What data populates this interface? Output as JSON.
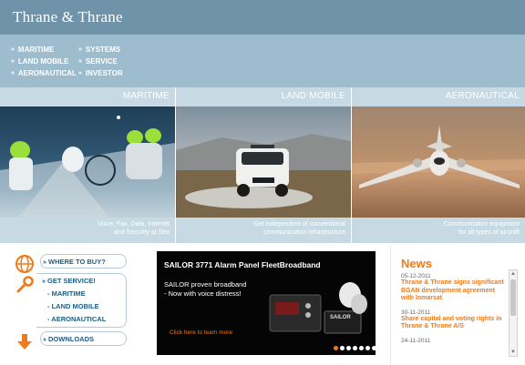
{
  "header": {
    "logo": "Thrane & Thrane"
  },
  "nav": {
    "col1": [
      "MARITIME",
      "LAND MOBILE",
      "AERONAUTICAL"
    ],
    "col2": [
      "SYSTEMS",
      "SERVICE",
      "INVESTOR"
    ]
  },
  "panels": [
    {
      "title": "MARITIME",
      "caption": [
        "Voice, Fax, Data, Internet",
        "and Security at Sea"
      ]
    },
    {
      "title": "LAND MOBILE",
      "caption": [
        "Get independent of conventional",
        "communication infrastructure"
      ]
    },
    {
      "title": "AERONAUTICAL",
      "caption": [
        "Communication equipment",
        "for all types of aircraft"
      ]
    }
  ],
  "menu": {
    "where_to_buy": "WHERE TO BUY?",
    "get_service": "GET SERVICE!",
    "service_links": [
      "- MARITIME",
      "- LAND MOBILE",
      "- AERONAUTICAL"
    ],
    "downloads": "DOWNLOADS"
  },
  "banner": {
    "title": "SAILOR 3771 Alarm Panel FleetBroadband",
    "subtitle_1": "SAILOR proven broadband",
    "subtitle_2": "- Now with voice distress!",
    "cta": "Click here to learn more",
    "device_label": "SAILOR",
    "dots": 7,
    "active_dot": 0
  },
  "news": {
    "title": "News",
    "items": [
      {
        "date": "05-12-2011",
        "text": "Thrane & Thrane signs significant BGAN development agreement with Inmarsat"
      },
      {
        "date": "30-11-2011",
        "text": "Share capital and voting rights in Thrane & Thrane A/S"
      },
      {
        "date": "24-11-2011",
        "text": ""
      }
    ]
  },
  "colors": {
    "header": "#6f93a9",
    "subheader": "#9dbccd",
    "panel_band": "#c7dae4",
    "link_blue": "#1c5d86",
    "accent_orange": "#f07a1a"
  }
}
